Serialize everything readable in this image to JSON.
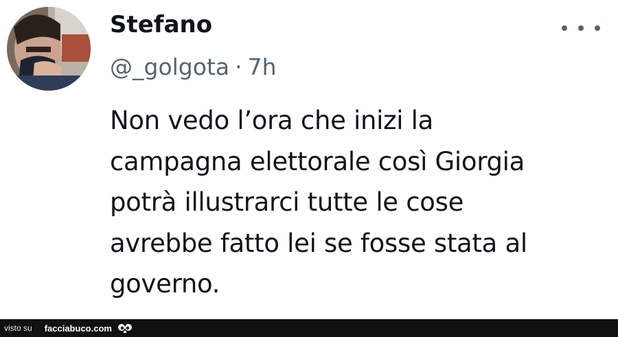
{
  "tweet": {
    "display_name": "Stefano",
    "handle": "@_golgota",
    "separator": "·",
    "time": "7h",
    "text": "Non vedo l’ora che inizi la\ncampagna elettorale così Giorgia\npotrà illustrarci tutte le cose\navrebbe fatto lei se fosse stata al\ngoverno.",
    "more_icon": "more-horizontal-icon",
    "avatar_icon": "profile-photo"
  },
  "footer": {
    "prefix": "visto su",
    "site": "facciabuco.com",
    "logo_icon": "eyes-icon"
  },
  "colors": {
    "name": "#0f1419",
    "meta": "#536471",
    "footer_bg": "#111111"
  }
}
